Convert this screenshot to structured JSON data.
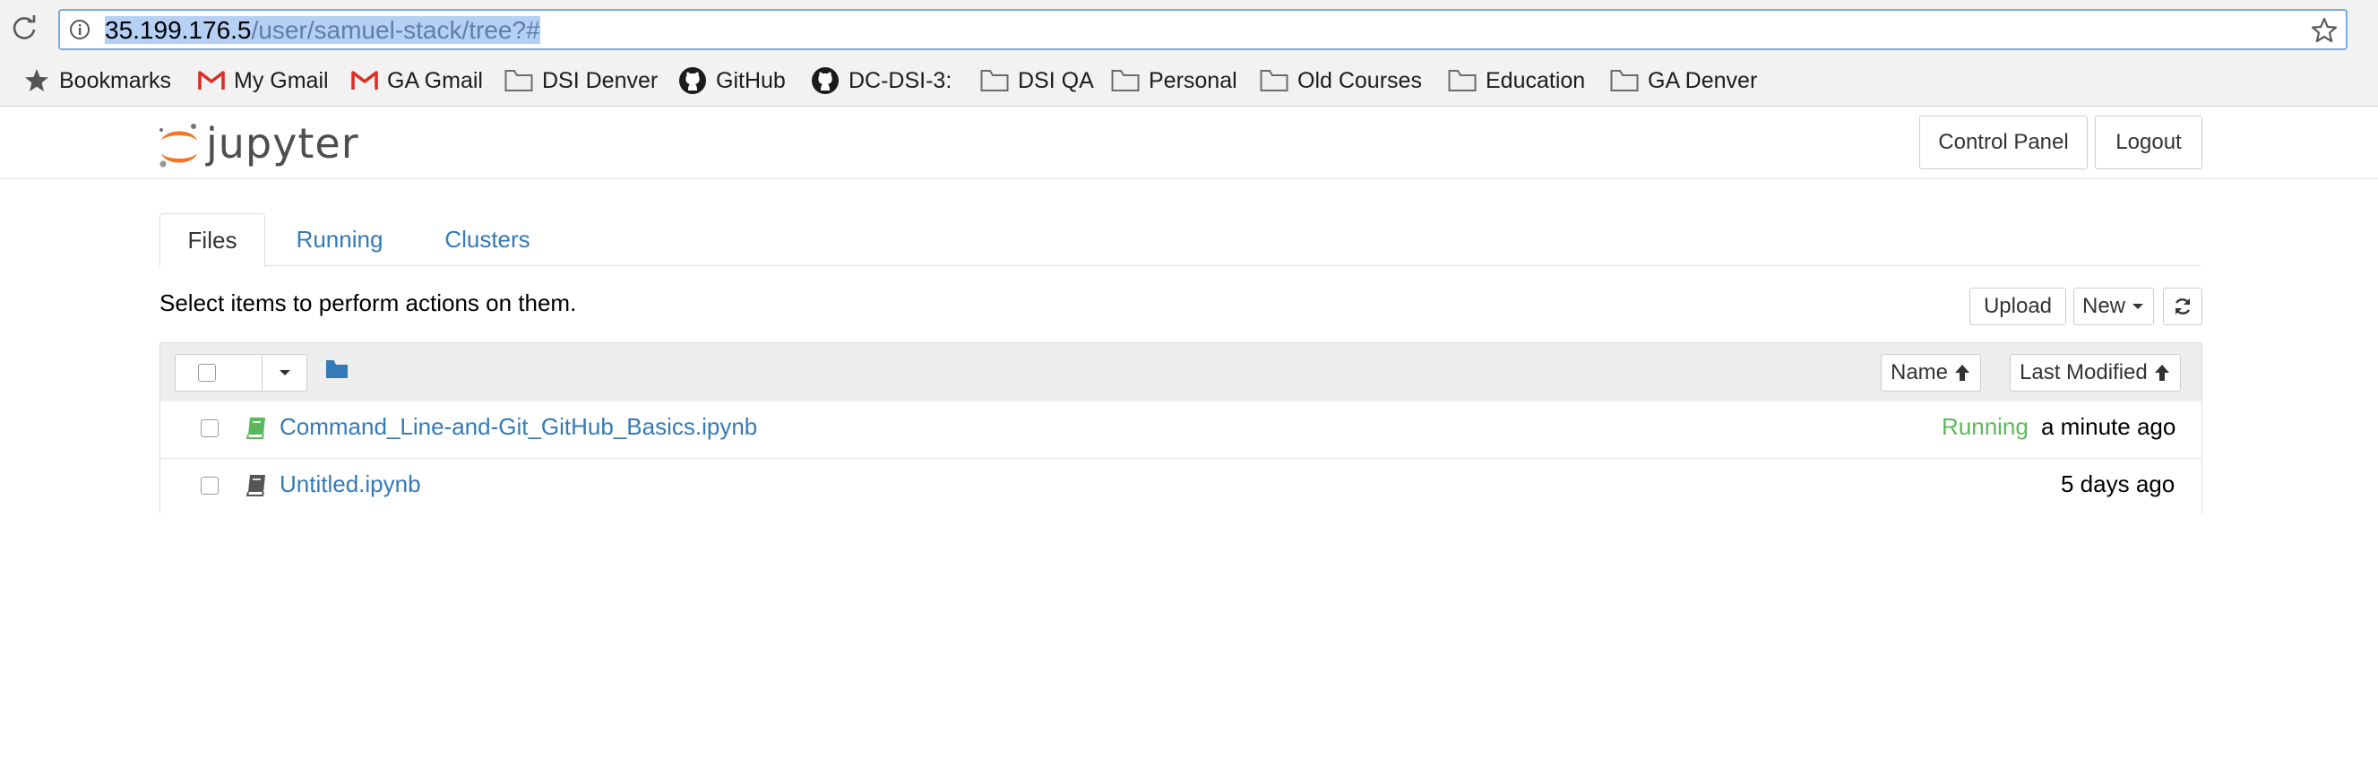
{
  "browser": {
    "url_host": "35.199.176.5",
    "url_path": "/user/samuel-stack/tree?#",
    "bookmarks": [
      {
        "label": "Bookmarks",
        "icon": "star-icon"
      },
      {
        "label": "My Gmail",
        "icon": "gmail-icon"
      },
      {
        "label": "GA Gmail",
        "icon": "gmail-icon"
      },
      {
        "label": "DSI Denver",
        "icon": "folder-icon"
      },
      {
        "label": "GitHub",
        "icon": "github-icon"
      },
      {
        "label": "DC-DSI-3:",
        "icon": "github-icon"
      },
      {
        "label": "DSI QA",
        "icon": "folder-icon"
      },
      {
        "label": "Personal",
        "icon": "folder-icon"
      },
      {
        "label": "Old Courses",
        "icon": "folder-icon"
      },
      {
        "label": "Education",
        "icon": "folder-icon"
      },
      {
        "label": "GA Denver",
        "icon": "folder-icon"
      }
    ]
  },
  "header": {
    "logo_text": "jupyter",
    "control_panel": "Control Panel",
    "logout": "Logout"
  },
  "tabs": [
    {
      "label": "Files",
      "active": true
    },
    {
      "label": "Running",
      "active": false
    },
    {
      "label": "Clusters",
      "active": false
    }
  ],
  "toolbar": {
    "hint": "Select items to perform actions on them.",
    "upload": "Upload",
    "new": "New"
  },
  "list": {
    "sort_name": "Name",
    "sort_modified": "Last Modified",
    "files": [
      {
        "name": "Command_Line-and-Git_GitHub_Basics.ipynb",
        "status": "Running",
        "modified": "a minute ago",
        "icon_color": "#5cb85c"
      },
      {
        "name": "Untitled.ipynb",
        "status": "",
        "modified": "5 days ago",
        "icon_color": "#555555"
      }
    ]
  },
  "colors": {
    "link": "#337ab7",
    "running": "#5cb85c",
    "jupyter_orange": "#f37726"
  }
}
